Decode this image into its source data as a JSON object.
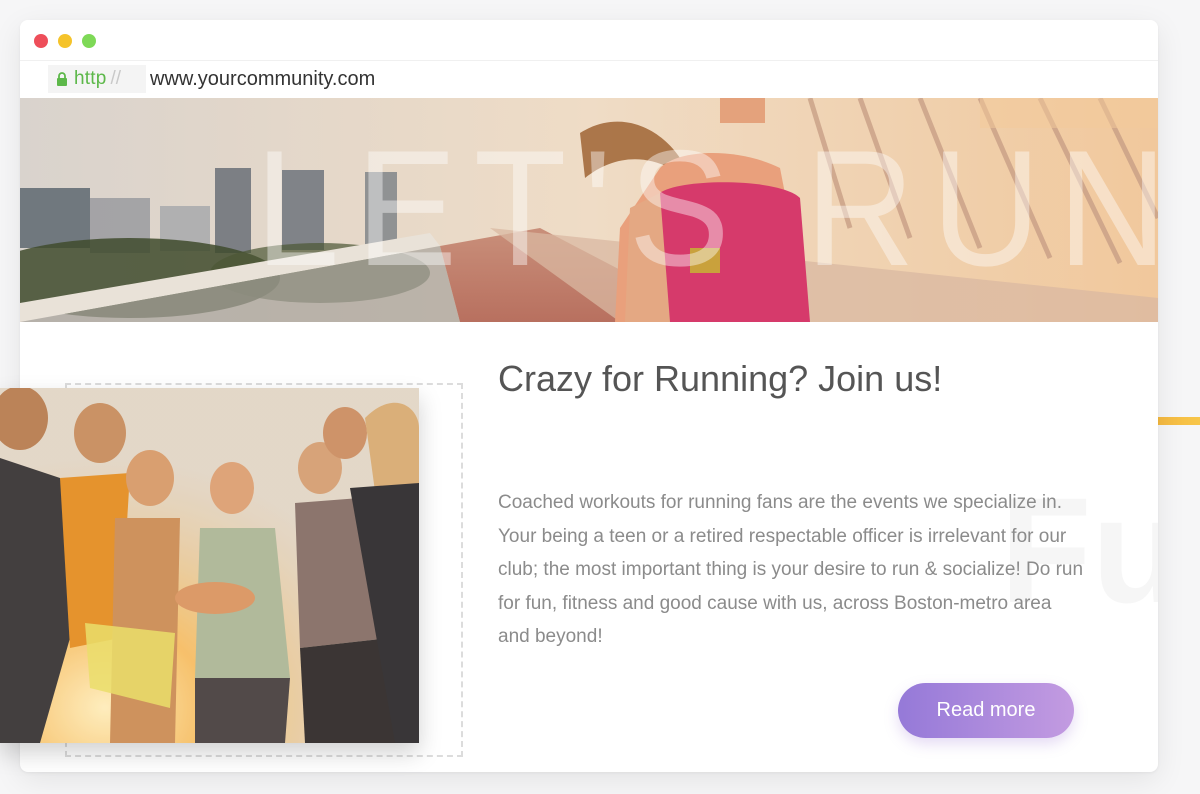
{
  "window": {
    "controls": [
      "close",
      "minimize",
      "maximize"
    ],
    "colors": {
      "close": "#ee4e5a",
      "minimize": "#f5c32a",
      "maximize": "#7ed957"
    }
  },
  "address": {
    "protocol": "http",
    "separator": "//",
    "url": "www.yourcommunity.com",
    "secure_icon": "lock-icon"
  },
  "hero": {
    "watermark": "LET'S RUN"
  },
  "content": {
    "title": "Crazy for Running? Join us!",
    "body": "Coached workouts for running fans are the events we specialize in. Your being a teen or a retired respectable officer is irrelevant for our club; the most important thing is your desire to run & socialize! Do run for fun, fitness and good cause with us, across Boston-metro area and beyond!",
    "watermark": "Fur",
    "button_label": "Read more"
  },
  "colors": {
    "accent_line": [
      "#ec6a1a",
      "#f7c64a"
    ],
    "button": [
      "#9579d8",
      "#c39be1"
    ],
    "url_protocol": "#5db84a"
  }
}
